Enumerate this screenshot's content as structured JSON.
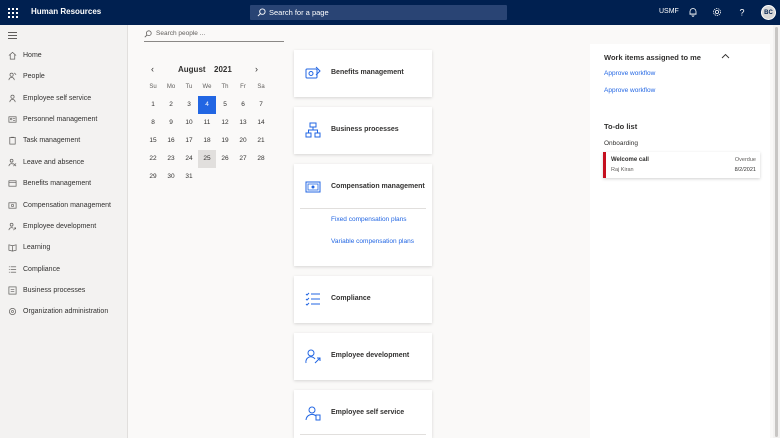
{
  "topbar": {
    "app_title": "Human Resources",
    "search_placeholder": "Search for a page",
    "company": "USMF",
    "avatar_initials": "BC"
  },
  "sidebar": {
    "items": [
      {
        "label": "Home",
        "icon": "home-icon"
      },
      {
        "label": "People",
        "icon": "people-icon"
      },
      {
        "label": "Employee self service",
        "icon": "person-icon"
      },
      {
        "label": "Personnel management",
        "icon": "personnel-icon"
      },
      {
        "label": "Task management",
        "icon": "clipboard-icon"
      },
      {
        "label": "Leave and absence",
        "icon": "leave-icon"
      },
      {
        "label": "Benefits management",
        "icon": "benefits-icon"
      },
      {
        "label": "Compensation management",
        "icon": "compensation-icon"
      },
      {
        "label": "Employee development",
        "icon": "development-icon"
      },
      {
        "label": "Learning",
        "icon": "learning-icon"
      },
      {
        "label": "Compliance",
        "icon": "compliance-icon"
      },
      {
        "label": "Business processes",
        "icon": "processes-icon"
      },
      {
        "label": "Organization administration",
        "icon": "organization-icon"
      }
    ]
  },
  "people_search": {
    "placeholder": "Search people ..."
  },
  "calendar": {
    "month": "August",
    "year": "2021",
    "weekdays": [
      "Su",
      "Mo",
      "Tu",
      "We",
      "Th",
      "Fr",
      "Sa"
    ],
    "weeks": [
      [
        "1",
        "2",
        "3",
        "4",
        "5",
        "6",
        "7"
      ],
      [
        "8",
        "9",
        "10",
        "11",
        "12",
        "13",
        "14"
      ],
      [
        "15",
        "16",
        "17",
        "18",
        "19",
        "20",
        "21"
      ],
      [
        "22",
        "23",
        "24",
        "25",
        "26",
        "27",
        "28"
      ],
      [
        "29",
        "30",
        "31",
        "",
        "",
        "",
        ""
      ]
    ],
    "selected_day": "4",
    "marked_day": "25"
  },
  "cards": [
    {
      "title": "Benefits management",
      "icon": "benefits-card-icon",
      "links": []
    },
    {
      "title": "Business processes",
      "icon": "processes-card-icon",
      "links": []
    },
    {
      "title": "Compensation management",
      "icon": "compensation-card-icon",
      "links": [
        "Fixed compensation plans",
        "Variable compensation plans"
      ]
    },
    {
      "title": "Compliance",
      "icon": "compliance-card-icon",
      "links": []
    },
    {
      "title": "Employee development",
      "icon": "development-card-icon",
      "links": []
    },
    {
      "title": "Employee self service",
      "icon": "self-service-card-icon",
      "links": []
    }
  ],
  "work_items": {
    "title": "Work items assigned to me",
    "links": [
      "Approve workflow",
      "Approve workflow"
    ]
  },
  "todo": {
    "title": "To-do list",
    "group": "Onboarding",
    "item": {
      "name": "Welcome call",
      "person": "Raj Kiran",
      "status": "Overdue",
      "date": "8/2/2021"
    }
  },
  "colors": {
    "topbar": "#002050",
    "accent": "#2266e3",
    "overdue": "#c50f1f"
  }
}
